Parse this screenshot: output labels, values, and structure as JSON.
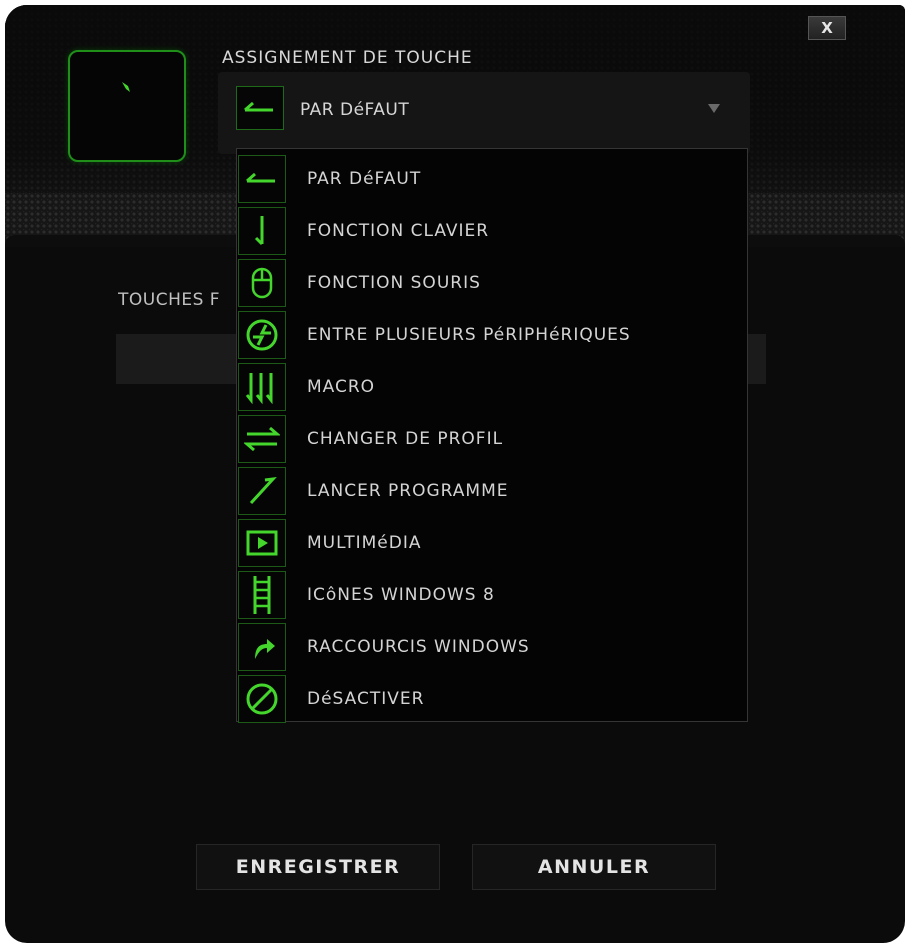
{
  "window": {
    "close_label": "X"
  },
  "section_title": "ASSIGNEMENT DE TOUCHE",
  "select": {
    "value": "PAR DéFAUT",
    "icon": "arrow-left-icon"
  },
  "sub_section": {
    "label": "TOUCHES F"
  },
  "dropdown": {
    "items": [
      {
        "label": "PAR DéFAUT",
        "icon": "arrow-left-icon"
      },
      {
        "label": "FONCTION CLAVIER",
        "icon": "arrow-down-icon"
      },
      {
        "label": "FONCTION SOURIS",
        "icon": "mouse-icon"
      },
      {
        "label": "ENTRE PLUSIEURS PéRIPHéRIQUES",
        "icon": "inter-device-icon"
      },
      {
        "label": "MACRO",
        "icon": "macro-icon"
      },
      {
        "label": "CHANGER DE PROFIL",
        "icon": "switch-profile-icon"
      },
      {
        "label": "LANCER PROGRAMME",
        "icon": "launch-program-icon"
      },
      {
        "label": "MULTIMéDIA",
        "icon": "multimedia-icon"
      },
      {
        "label": "ICôNES WINDOWS 8",
        "icon": "windows8-charms-icon"
      },
      {
        "label": "RACCOURCIS WINDOWS",
        "icon": "windows-shortcut-icon"
      },
      {
        "label": "DéSACTIVER",
        "icon": "disable-icon"
      }
    ]
  },
  "buttons": {
    "save": "ENREGISTRER",
    "cancel": "ANNULER"
  },
  "colors": {
    "accent": "#44d62c",
    "background": "#0b0b0b",
    "text": "#d4d4d4"
  }
}
